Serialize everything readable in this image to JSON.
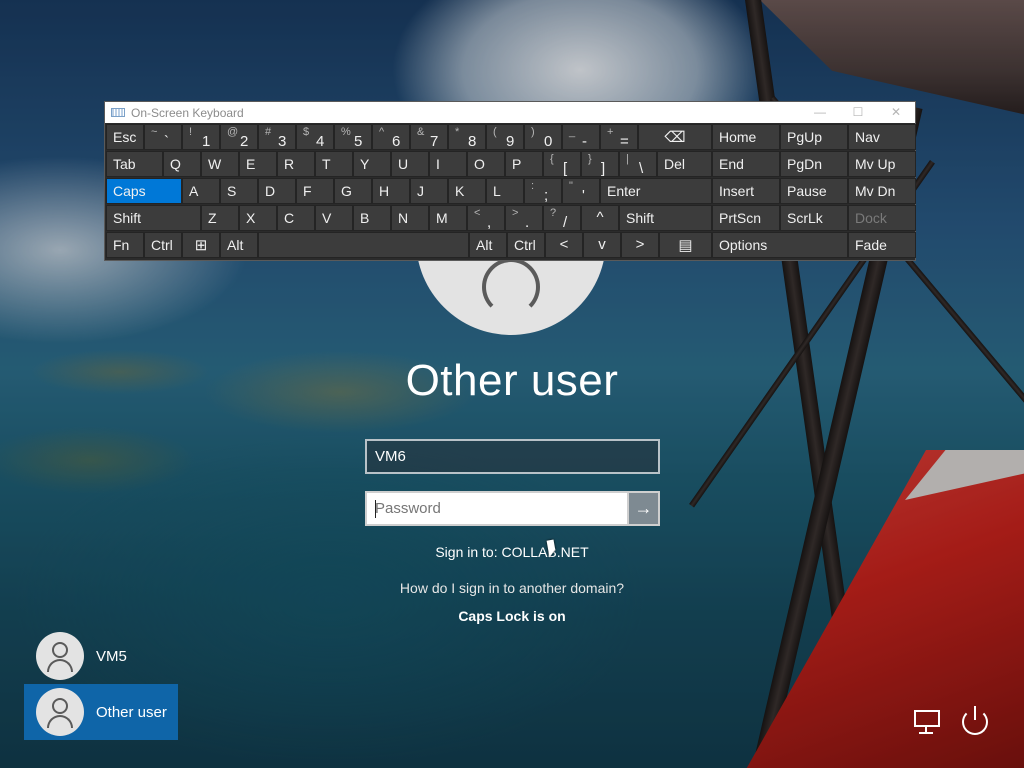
{
  "osk": {
    "title": "On-Screen Keyboard",
    "controls": [
      "—",
      "☐",
      "✕"
    ],
    "rows": [
      [
        {
          "label": "Esc"
        },
        {
          "sup": "~",
          "main": "`"
        },
        {
          "sup": "!",
          "main": "1"
        },
        {
          "sup": "@",
          "main": "2"
        },
        {
          "sup": "#",
          "main": "3"
        },
        {
          "sup": "$",
          "main": "4"
        },
        {
          "sup": "%",
          "main": "5"
        },
        {
          "sup": "^",
          "main": "6"
        },
        {
          "sup": "&",
          "main": "7"
        },
        {
          "sup": "*",
          "main": "8"
        },
        {
          "sup": "(",
          "main": "9"
        },
        {
          "sup": ")",
          "main": "0"
        },
        {
          "sup": "_",
          "main": "-"
        },
        {
          "sup": "+",
          "main": "="
        },
        {
          "glyph": "⌫"
        }
      ],
      [
        {
          "label": "Tab"
        },
        {
          "label": "Q"
        },
        {
          "label": "W"
        },
        {
          "label": "E"
        },
        {
          "label": "R"
        },
        {
          "label": "T"
        },
        {
          "label": "Y"
        },
        {
          "label": "U"
        },
        {
          "label": "I"
        },
        {
          "label": "O"
        },
        {
          "label": "P"
        },
        {
          "sup": "{",
          "main": "["
        },
        {
          "sup": "}",
          "main": "]"
        },
        {
          "sup": "|",
          "main": "\\"
        },
        {
          "label": "Del"
        }
      ],
      [
        {
          "label": "Caps"
        },
        {
          "label": "A"
        },
        {
          "label": "S"
        },
        {
          "label": "D"
        },
        {
          "label": "F"
        },
        {
          "label": "G"
        },
        {
          "label": "H"
        },
        {
          "label": "J"
        },
        {
          "label": "K"
        },
        {
          "label": "L"
        },
        {
          "sup": ":",
          "main": ";"
        },
        {
          "sup": "\"",
          "main": "'"
        },
        {
          "label": "Enter"
        }
      ],
      [
        {
          "label": "Shift"
        },
        {
          "label": "Z"
        },
        {
          "label": "X"
        },
        {
          "label": "C"
        },
        {
          "label": "V"
        },
        {
          "label": "B"
        },
        {
          "label": "N"
        },
        {
          "label": "M"
        },
        {
          "sup": "<",
          "main": ","
        },
        {
          "sup": ">",
          "main": "."
        },
        {
          "sup": "?",
          "main": "/"
        },
        {
          "glyph": "^"
        },
        {
          "label": "Shift"
        }
      ],
      [
        {
          "label": "Fn"
        },
        {
          "label": "Ctrl"
        },
        {
          "glyph": "⊞"
        },
        {
          "label": "Alt"
        },
        {
          "label": ""
        },
        {
          "label": "Alt"
        },
        {
          "label": "Ctrl"
        },
        {
          "glyph": "<"
        },
        {
          "glyph": "v"
        },
        {
          "glyph": ">"
        },
        {
          "glyph": "▤"
        }
      ]
    ],
    "nav_rows": [
      [
        {
          "label": "Home"
        },
        {
          "label": "PgUp"
        },
        {
          "label": "Nav"
        }
      ],
      [
        {
          "label": "End"
        },
        {
          "label": "PgDn"
        },
        {
          "label": "Mv Up"
        }
      ],
      [
        {
          "label": "Insert"
        },
        {
          "label": "Pause"
        },
        {
          "label": "Mv Dn"
        }
      ],
      [
        {
          "label": "PrtScn"
        },
        {
          "label": "ScrLk"
        },
        {
          "label": "Dock",
          "disabled": true
        }
      ],
      [
        {
          "label": "Options"
        },
        {
          "label": "Fade"
        }
      ]
    ],
    "active_key": "Caps",
    "active_color": "#0078d7"
  },
  "login": {
    "title": "Other user",
    "username_value": "VM6",
    "password_placeholder": "Password",
    "submit_icon": "arrow-right-icon",
    "submit_glyph": "→",
    "sign_in_to": "Sign in to: COLLAB.NET",
    "domain_link": "How do I sign in to another domain?",
    "caps_notice": "Caps Lock is on"
  },
  "users": [
    {
      "name": "VM5",
      "selected": false
    },
    {
      "name": "Other user",
      "selected": true
    }
  ],
  "corner_icons": [
    "network-icon",
    "power-icon"
  ],
  "selected_color": "#0f65a8"
}
